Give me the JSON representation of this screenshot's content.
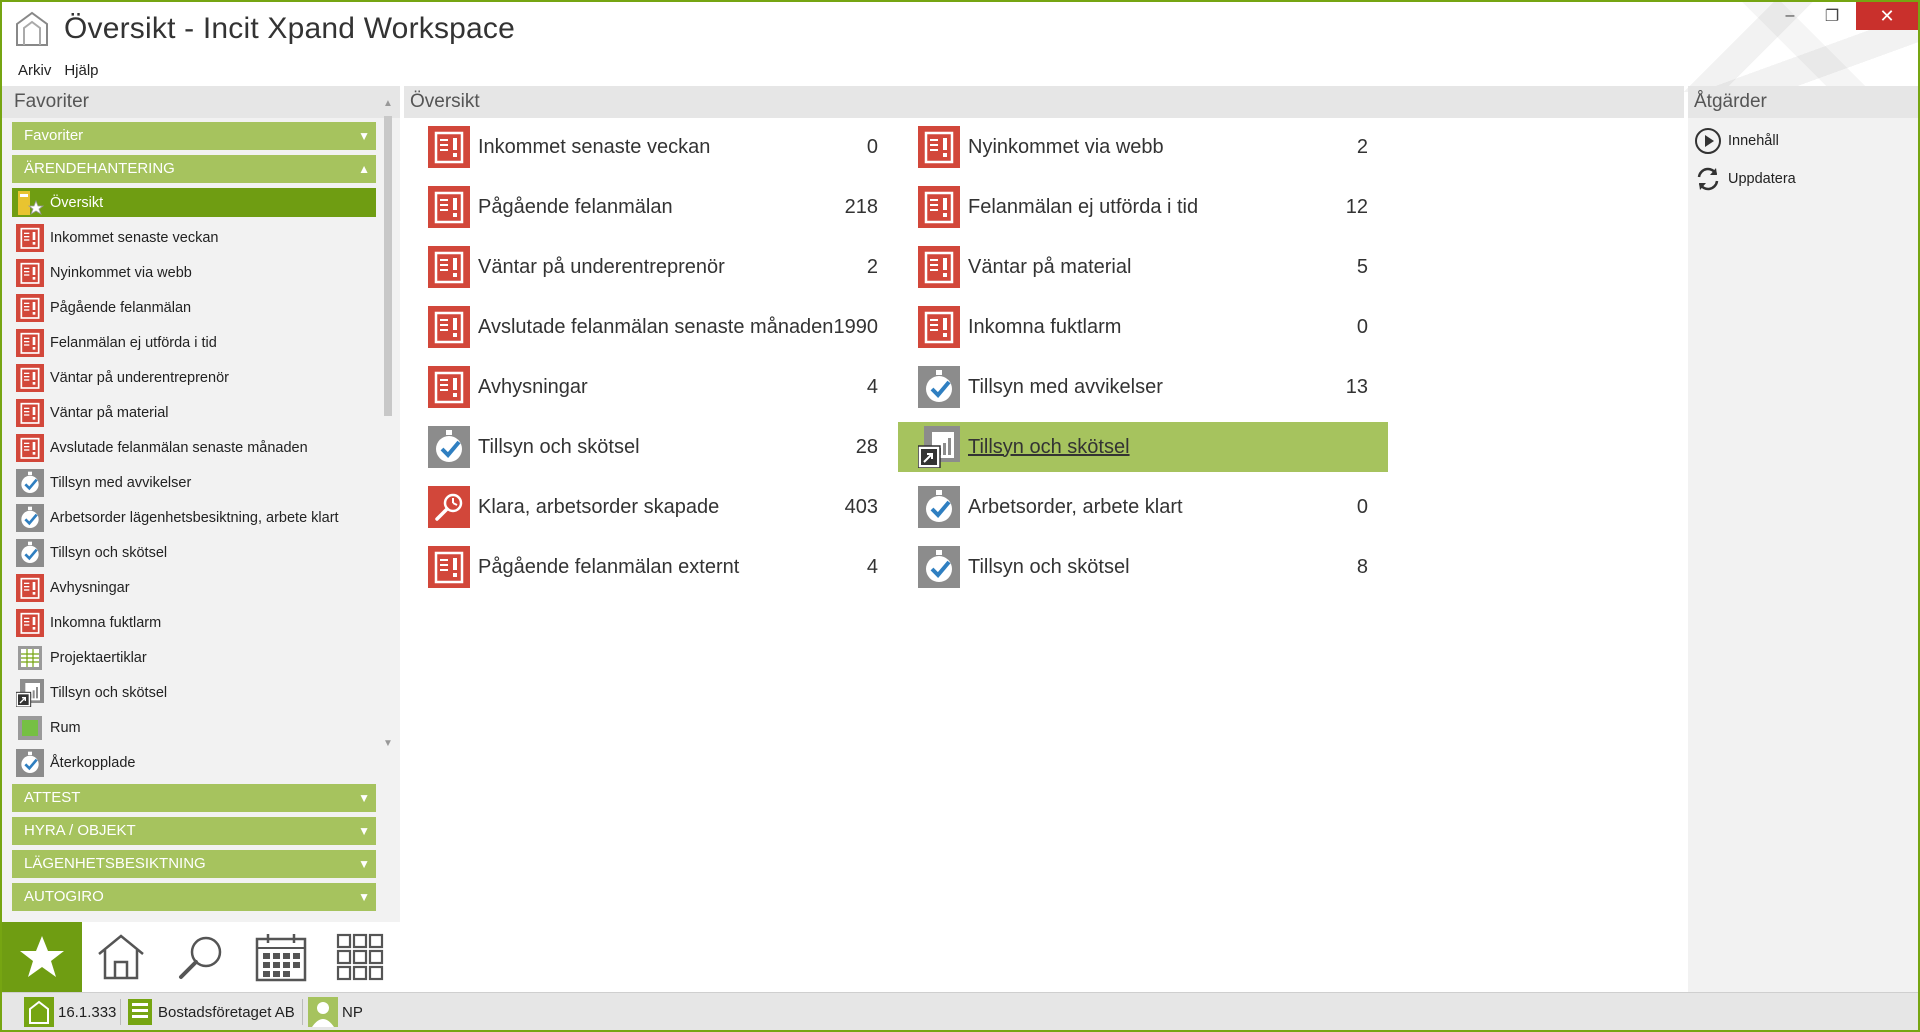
{
  "window": {
    "title": "Översikt - Incit Xpand Workspace",
    "controls": {
      "minimize": "–",
      "maximize": "❐",
      "close": "✕"
    }
  },
  "menu": [
    "Arkiv",
    "Hjälp"
  ],
  "left": {
    "header": "Favoriter",
    "groups_top": [
      {
        "label": "Favoriter",
        "expanded": false
      },
      {
        "label": "ÄRENDEHANTERING",
        "expanded": true
      }
    ],
    "items": [
      {
        "label": "Översikt",
        "icon": "overview-star-icon",
        "active": true
      },
      {
        "label": "Inkommet senaste veckan",
        "icon": "report-icon"
      },
      {
        "label": "Nyinkommet via webb",
        "icon": "report-icon"
      },
      {
        "label": "Pågående felanmälan",
        "icon": "report-icon"
      },
      {
        "label": "Felanmälan ej utförda i tid",
        "icon": "report-icon"
      },
      {
        "label": "Väntar på underentreprenör",
        "icon": "report-icon"
      },
      {
        "label": "Väntar på material",
        "icon": "report-icon"
      },
      {
        "label": "Avslutade felanmälan senaste månaden",
        "icon": "report-icon"
      },
      {
        "label": "Tillsyn med avvikelser",
        "icon": "inspection-icon"
      },
      {
        "label": "Arbetsorder lägenhetsbesiktning, arbete klart",
        "icon": "inspection-icon"
      },
      {
        "label": "Tillsyn och skötsel",
        "icon": "inspection-icon"
      },
      {
        "label": "Avhysningar",
        "icon": "report-icon"
      },
      {
        "label": "Inkomna fuktlarm",
        "icon": "report-icon"
      },
      {
        "label": "Projektaertiklar",
        "icon": "table-icon"
      },
      {
        "label": "Tillsyn och skötsel",
        "icon": "shortcut-chart-icon"
      },
      {
        "label": "Rum",
        "icon": "room-icon"
      },
      {
        "label": "Återkopplade",
        "icon": "inspection-icon"
      }
    ],
    "groups_bottom": [
      {
        "label": "ATTEST"
      },
      {
        "label": "HYRA / OBJEKT"
      },
      {
        "label": "LÄGENHETSBESIKTNING"
      },
      {
        "label": "AUTOGIRO"
      }
    ],
    "tabs": [
      "favorites-star-icon",
      "home-icon",
      "search-icon",
      "calendar-icon",
      "grid-icon"
    ]
  },
  "center": {
    "header": "Översikt",
    "col1": [
      {
        "label": "Inkommet senaste veckan",
        "count": "0",
        "icon": "report-icon"
      },
      {
        "label": "Pågående felanmälan",
        "count": "218",
        "icon": "report-icon"
      },
      {
        "label": "Väntar på underentreprenör",
        "count": "2",
        "icon": "report-icon"
      },
      {
        "label": "Avslutade felanmälan senaste månaden",
        "count": "1990",
        "icon": "report-icon"
      },
      {
        "label": "Avhysningar",
        "count": "4",
        "icon": "report-icon"
      },
      {
        "label": "Tillsyn och skötsel",
        "count": "28",
        "icon": "inspection-icon"
      },
      {
        "label": "Klara, arbetsorder skapade",
        "count": "403",
        "icon": "search-report-icon"
      },
      {
        "label": "Pågående felanmälan externt",
        "count": "4",
        "icon": "report-icon"
      }
    ],
    "col2": [
      {
        "label": "Nyinkommet via webb",
        "count": "2",
        "icon": "report-icon"
      },
      {
        "label": "Felanmälan ej utförda i tid",
        "count": "12",
        "icon": "report-icon"
      },
      {
        "label": "Väntar på material",
        "count": "5",
        "icon": "report-icon"
      },
      {
        "label": "Inkomna fuktlarm",
        "count": "0",
        "icon": "report-icon"
      },
      {
        "label": "Tillsyn med avvikelser",
        "count": "13",
        "icon": "inspection-icon"
      },
      {
        "label": "Tillsyn och skötsel",
        "count": "",
        "icon": "shortcut-chart-icon",
        "selected": true
      },
      {
        "label": "Arbetsorder, arbete klart",
        "count": "0",
        "icon": "inspection-icon"
      },
      {
        "label": "Tillsyn och skötsel",
        "count": "8",
        "icon": "inspection-icon"
      }
    ]
  },
  "right": {
    "header": "Åtgärder",
    "actions": [
      {
        "label": "Innehåll",
        "icon": "play-circle-icon"
      },
      {
        "label": "Uppdatera",
        "icon": "refresh-icon"
      }
    ]
  },
  "status": {
    "version": "16.1.333",
    "company": "Bostadsföretaget AB",
    "user": "NP"
  },
  "colors": {
    "accent_dark": "#6f9d12",
    "accent_light": "#a6c35e",
    "report_red": "#d2473a",
    "close_red": "#c9302c"
  }
}
